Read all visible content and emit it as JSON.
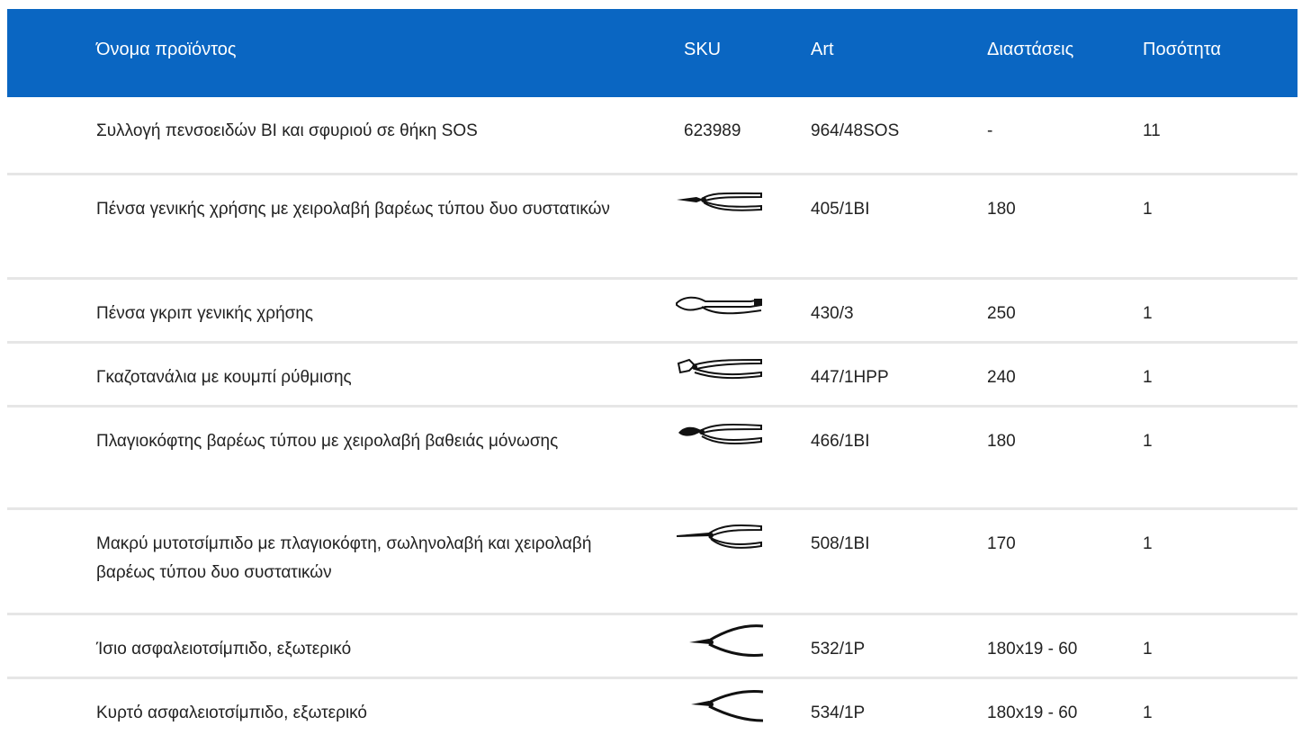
{
  "header": {
    "name": "Όνομα προϊόντος",
    "sku": "SKU",
    "art": "Art",
    "dimensions": "Διαστάσεις",
    "quantity": "Ποσότητα"
  },
  "rows": [
    {
      "name": "Συλλογή πενσοειδών BI και σφυριού σε θήκη SOS",
      "sku": "623989",
      "art": "964/48SOS",
      "dimensions": "-",
      "quantity": "11",
      "icon": ""
    },
    {
      "name": "Πένσα γενικής χρήσης με χειρολαβή βαρέως τύπου δυο συστατικών",
      "sku": "",
      "art": "405/1BI",
      "dimensions": "180",
      "quantity": "1",
      "icon": "combination-pliers-icon"
    },
    {
      "name": "Πένσα γκριπ γενικής χρήσης",
      "sku": "",
      "art": "430/3",
      "dimensions": "250",
      "quantity": "1",
      "icon": "locking-pliers-icon"
    },
    {
      "name": "Γκαζοτανάλια με κουμπί ρύθμισης",
      "sku": "",
      "art": "447/1HPP",
      "dimensions": "240",
      "quantity": "1",
      "icon": "water-pump-pliers-icon"
    },
    {
      "name": "Πλαγιοκόφτης βαρέως τύπου με χειρολαβή βαθειάς μόνωσης",
      "sku": "",
      "art": "466/1BI",
      "dimensions": "180",
      "quantity": "1",
      "icon": "side-cutter-icon"
    },
    {
      "name": "Μακρύ μυτοτσίμπιδο με πλαγιοκόφτη, σωληνολαβή και χειρολαβή βαρέως τύπου δυο συστατικών",
      "sku": "",
      "art": "508/1BI",
      "dimensions": "170",
      "quantity": "1",
      "icon": "long-nose-pliers-icon"
    },
    {
      "name": "Ίσιο ασφαλειοτσίμπιδο, εξωτερικό",
      "sku": "",
      "art": "532/1P",
      "dimensions": "180x19 - 60",
      "quantity": "1",
      "icon": "straight-circlip-pliers-icon"
    },
    {
      "name": "Κυρτό ασφαλειοτσίμπιδο, εξωτερικό",
      "sku": "",
      "art": "534/1P",
      "dimensions": "180x19 - 60",
      "quantity": "1",
      "icon": "bent-circlip-pliers-icon"
    }
  ]
}
